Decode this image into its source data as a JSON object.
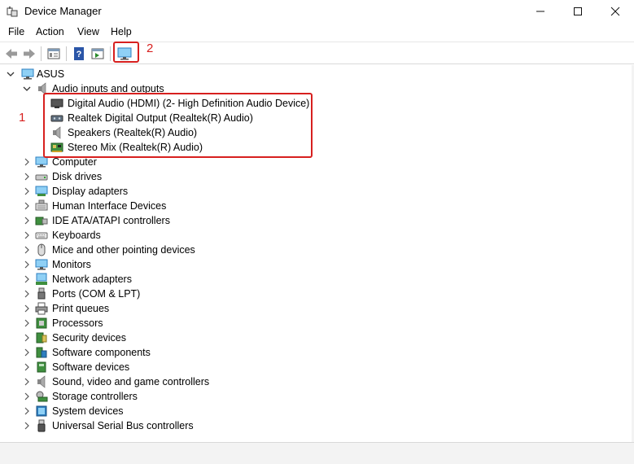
{
  "window": {
    "title": "Device Manager",
    "icon": "device-manager-icon"
  },
  "controls": {
    "minimize": "minimize-icon",
    "maximize": "maximize-icon",
    "close": "close-icon"
  },
  "menu": [
    {
      "label": "File"
    },
    {
      "label": "Action"
    },
    {
      "label": "View"
    },
    {
      "label": "Help"
    }
  ],
  "toolbar": [
    {
      "icon": "back-arrow-icon"
    },
    {
      "icon": "forward-arrow-icon"
    },
    {
      "icon": "properties-icon"
    },
    {
      "icon": "help-icon"
    },
    {
      "icon": "action-pane-icon"
    },
    {
      "icon": "monitor-icon"
    }
  ],
  "annotations": {
    "callout_1": "1",
    "callout_2": "2",
    "highlight_color": "#d7201f"
  },
  "tree": {
    "root": {
      "label": "ASUS",
      "icon": "computer-icon",
      "expanded": true
    },
    "categories": [
      {
        "label": "Audio inputs and outputs",
        "icon": "speaker-icon",
        "expanded": true,
        "children": [
          {
            "label": "Digital Audio (HDMI) (2- High Definition Audio Device)",
            "icon": "monitor-device-icon"
          },
          {
            "label": "Realtek Digital Output (Realtek(R) Audio)",
            "icon": "digital-output-icon"
          },
          {
            "label": "Speakers (Realtek(R) Audio)",
            "icon": "speaker-icon"
          },
          {
            "label": "Stereo Mix (Realtek(R) Audio)",
            "icon": "sound-card-icon"
          }
        ]
      },
      {
        "label": "Computer",
        "icon": "monitor-icon",
        "expanded": false
      },
      {
        "label": "Disk drives",
        "icon": "disk-drive-icon",
        "expanded": false
      },
      {
        "label": "Display adapters",
        "icon": "display-adapter-icon",
        "expanded": false
      },
      {
        "label": "Human Interface Devices",
        "icon": "hid-icon",
        "expanded": false
      },
      {
        "label": "IDE ATA/ATAPI controllers",
        "icon": "ide-controller-icon",
        "expanded": false
      },
      {
        "label": "Keyboards",
        "icon": "keyboard-icon",
        "expanded": false
      },
      {
        "label": "Mice and other pointing devices",
        "icon": "mouse-icon",
        "expanded": false
      },
      {
        "label": "Monitors",
        "icon": "monitor-icon",
        "expanded": false
      },
      {
        "label": "Network adapters",
        "icon": "network-adapter-icon",
        "expanded": false
      },
      {
        "label": "Ports (COM & LPT)",
        "icon": "port-icon",
        "expanded": false
      },
      {
        "label": "Print queues",
        "icon": "printer-icon",
        "expanded": false
      },
      {
        "label": "Processors",
        "icon": "processor-icon",
        "expanded": false
      },
      {
        "label": "Security devices",
        "icon": "security-device-icon",
        "expanded": false
      },
      {
        "label": "Software components",
        "icon": "software-component-icon",
        "expanded": false
      },
      {
        "label": "Software devices",
        "icon": "software-device-icon",
        "expanded": false
      },
      {
        "label": "Sound, video and game controllers",
        "icon": "speaker-icon",
        "expanded": false
      },
      {
        "label": "Storage controllers",
        "icon": "storage-controller-icon",
        "expanded": false
      },
      {
        "label": "System devices",
        "icon": "system-device-icon",
        "expanded": false
      },
      {
        "label": "Universal Serial Bus controllers",
        "icon": "usb-icon",
        "expanded": false
      }
    ]
  }
}
